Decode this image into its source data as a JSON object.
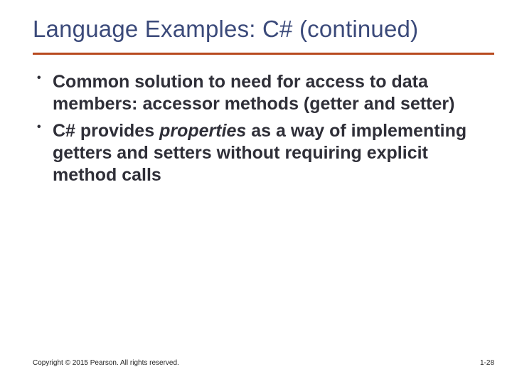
{
  "title": "Language Examples: C# (continued)",
  "bullets": [
    {
      "pre": "Common solution to need for access to data members: accessor methods (getter and setter)",
      "italic": "",
      "post": ""
    },
    {
      "pre": "C# provides ",
      "italic": "properties",
      "post": " as a way of implementing getters and setters without requiring explicit method calls"
    }
  ],
  "footer": {
    "copyright": "Copyright © 2015 Pearson. All rights reserved.",
    "page": "1-28"
  }
}
